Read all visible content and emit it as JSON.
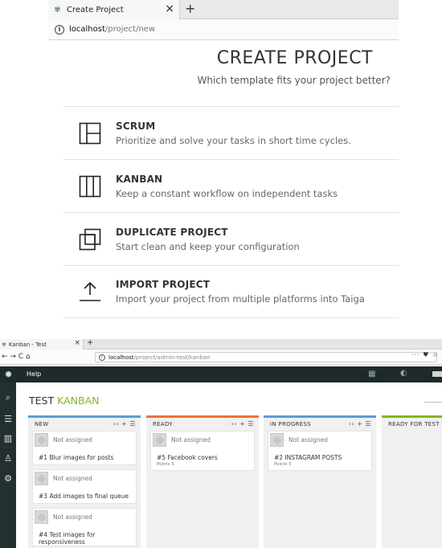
{
  "top_browser": {
    "tab_title": "Create Project",
    "tab_close": "×",
    "new_tab": "+",
    "url_host": "localhost",
    "url_path": "/project/new"
  },
  "create_project": {
    "title": "CREATE PROJECT",
    "subtitle": "Which template fits your project better?",
    "options": [
      {
        "title": "SCRUM",
        "desc": "Prioritize and solve your tasks in short time cycles.",
        "icon": "scrum-icon"
      },
      {
        "title": "KANBAN",
        "desc": "Keep a constant workflow on independent tasks",
        "icon": "kanban-icon"
      },
      {
        "title": "DUPLICATE PROJECT",
        "desc": "Start clean and keep your configuration",
        "icon": "duplicate-icon"
      },
      {
        "title": "IMPORT PROJECT",
        "desc": "Import your project from multiple platforms into Taiga",
        "icon": "import-icon"
      }
    ]
  },
  "kanban_browser": {
    "tab_title": "Kanban - Test",
    "tab_close": "×",
    "new_tab": "+",
    "url_host": "localhost",
    "url_path": "/project/admin-test/kanban",
    "nav_icons": "← → C ⌂",
    "tools": "··· ♥ ☆"
  },
  "kanban": {
    "help_label": "Help",
    "project_name": "TEST",
    "page_name": "KANBAN",
    "columns": [
      {
        "name": "NEW",
        "color": "#57a0d6",
        "tools": "›‹ + ☰",
        "cards": [
          {
            "assignee": "Not assigned",
            "name": "#1 Blur images for posts",
            "points": ""
          },
          {
            "assignee": "Not assigned",
            "name": "#3 Add images to final queue",
            "points": ""
          },
          {
            "assignee": "Not assigned",
            "name": "#4 Test images for responsiveness",
            "points": ""
          }
        ]
      },
      {
        "name": "READY",
        "color": "#e8743b",
        "tools": "›‹ + ☰",
        "cards": [
          {
            "assignee": "Not assigned",
            "name": "#5 Facebook covers",
            "points": "Points 5"
          }
        ]
      },
      {
        "name": "IN PROGRESS",
        "color": "#5f9ad8",
        "tools": "›‹ + ☰",
        "cards": [
          {
            "assignee": "Not assigned",
            "name": "#2 INSTAGRAM POSTS",
            "points": "Points 5"
          }
        ]
      },
      {
        "name": "READY FOR TEST",
        "color": "#84b51f",
        "tools": "",
        "cards": []
      }
    ]
  }
}
